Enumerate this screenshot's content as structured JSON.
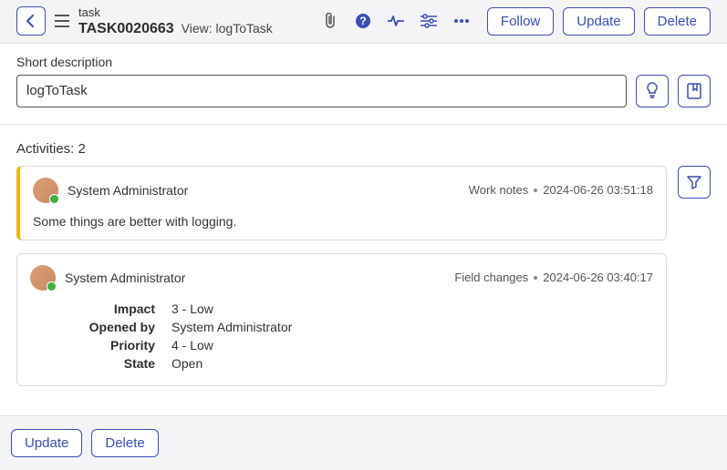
{
  "header": {
    "type_label": "task",
    "number": "TASK0020663",
    "view_label": "View:",
    "view_name": "logToTask",
    "follow": "Follow",
    "update": "Update",
    "delete": "Delete"
  },
  "form": {
    "short_desc_label": "Short description",
    "short_desc_value": "logToTask"
  },
  "activities": {
    "header": "Activities: 2",
    "a0": {
      "author": "System Administrator",
      "type": "Work notes",
      "time": "2024-06-26 03:51:18",
      "body": "Some things are better with logging."
    },
    "a1": {
      "author": "System Administrator",
      "type": "Field changes",
      "time": "2024-06-26 03:40:17",
      "rows": {
        "r0": {
          "label": "Impact",
          "val": "3 - Low"
        },
        "r1": {
          "label": "Opened by",
          "val": "System Administrator"
        },
        "r2": {
          "label": "Priority",
          "val": "4 - Low"
        },
        "r3": {
          "label": "State",
          "val": "Open"
        }
      }
    }
  },
  "footer": {
    "update": "Update",
    "delete": "Delete"
  }
}
